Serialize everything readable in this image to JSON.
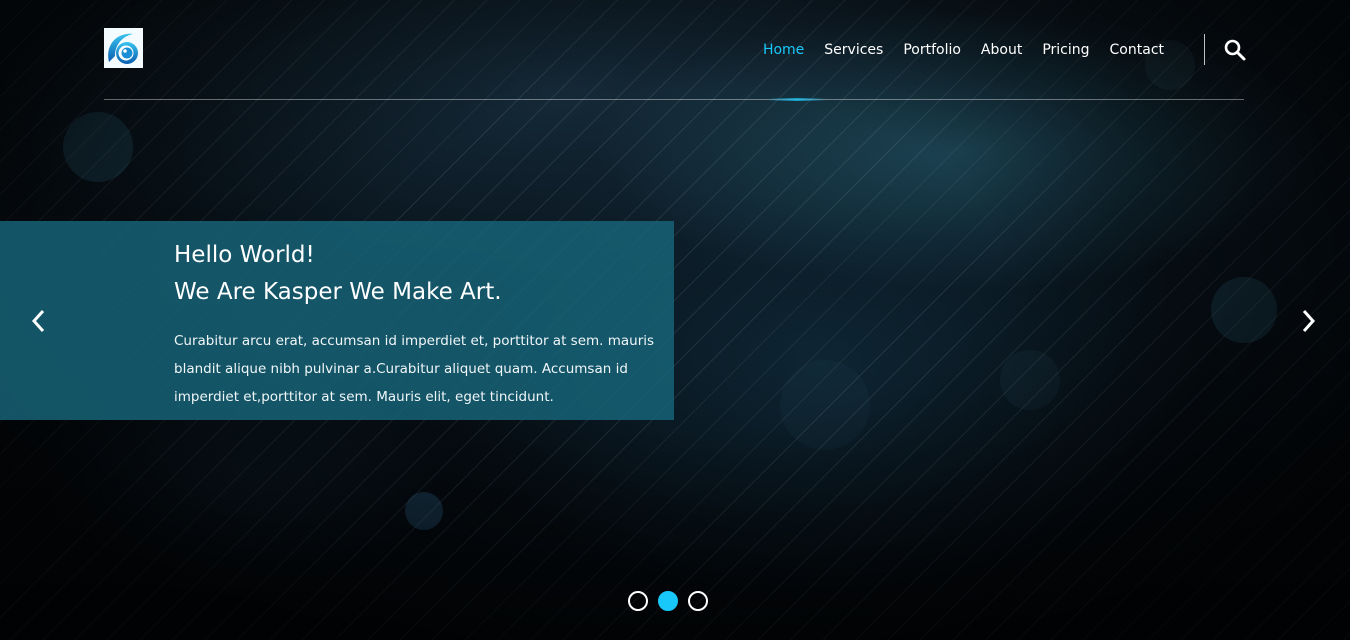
{
  "colors": {
    "accent": "#19c8fa",
    "caption_bg": "#17657a",
    "background": "#03070b"
  },
  "header": {
    "logo_icon": "kasper-logo-icon",
    "nav": [
      {
        "label": "Home",
        "active": true
      },
      {
        "label": "Services",
        "active": false
      },
      {
        "label": "Portfolio",
        "active": false
      },
      {
        "label": "About",
        "active": false
      },
      {
        "label": "Pricing",
        "active": false
      },
      {
        "label": "Contact",
        "active": false
      }
    ],
    "search_icon": "search-icon"
  },
  "slider": {
    "title_line1": "Hello World!",
    "title_line2": "We Are Kasper We Make Art.",
    "text": "Curabitur arcu erat, accumsan id imperdiet et, porttitor at sem. mauris blandit alique nibh pulvinar a.Curabitur aliquet quam. Accumsan id imperdiet et,porttitor at sem. Mauris elit, eget tincidunt.",
    "prev_icon": "chevron-left-icon",
    "next_icon": "chevron-right-icon",
    "slide_count": 3,
    "active_slide": 2
  }
}
